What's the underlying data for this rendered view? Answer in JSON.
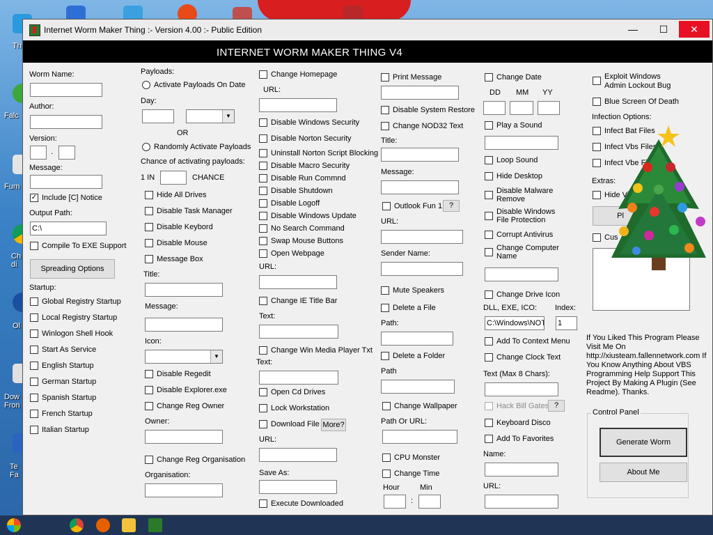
{
  "window": {
    "title": "Internet Worm Maker Thing :- Version 4.00 :- Public Edition",
    "banner": "INTERNET WORM MAKER THING V4",
    "controls": {
      "minimize": "—",
      "maximize": "☐",
      "close": "✕"
    }
  },
  "col1": {
    "worm_name_label": "Worm Name:",
    "author_label": "Author:",
    "version_label": "Version:",
    "version_dot": ".",
    "message_label": "Message:",
    "include_notice": "Include [C] Notice",
    "output_path_label": "Output Path:",
    "output_path_value": "C:\\",
    "compile_exe": "Compile To EXE Support",
    "spreading_options": "Spreading Options",
    "startup_label": "Startup:",
    "startup_items": [
      "Global Registry Startup",
      "Local Registry Startup",
      "Winlogon Shell Hook",
      "Start As Service",
      "English Startup",
      "German Startup",
      "Spanish Startup",
      "French Startup",
      "Italian Startup"
    ]
  },
  "col2": {
    "payloads_label": "Payloads:",
    "activate_on_date": "Activate Payloads On Date",
    "day_label": "Day:",
    "or_label": "OR",
    "randomly_activate": "Randomly Activate Payloads",
    "chance_label": "Chance of activating payloads:",
    "one_in": "1 IN",
    "chance": "CHANCE",
    "items1": [
      "Hide All Drives",
      "Disable Task Manager",
      "Disable Keybord",
      "Disable Mouse",
      "Message Box"
    ],
    "title_label": "Title:",
    "message_label": "Message:",
    "icon_label": "Icon:",
    "items2": [
      "Disable Regedit",
      "Disable Explorer.exe",
      "Change Reg Owner"
    ],
    "owner_label": "Owner:",
    "change_reg_org": "Change Reg Organisation",
    "organisation_label": "Organisation:"
  },
  "col3": {
    "change_homepage": "Change Homepage",
    "url_label": "URL:",
    "items1": [
      "Disable Windows Security",
      "Disable Norton Security",
      "Uninstall Norton Script Blocking",
      "Disable Macro Security",
      "Disable Run Commnd",
      "Disable Shutdown",
      "Disable Logoff",
      "Disable Windows Update",
      "No Search Command",
      "Swap Mouse Buttons",
      "Open Webpage"
    ],
    "url_label2": "URL:",
    "change_ie_title": "Change IE Title Bar",
    "text_label": "Text:",
    "change_media_player": "Change Win Media Player Txt",
    "text_label2": "Text:",
    "open_cd": "Open Cd Drives",
    "lock_workstation": "Lock Workstation",
    "download_file": "Download File",
    "more_btn": "More?",
    "url_label3": "URL:",
    "save_as_label": "Save As:",
    "execute_downloaded": "Execute Downloaded"
  },
  "col4": {
    "print_message": "Print Message",
    "disable_system_restore": "Disable System Restore",
    "change_nod32": "Change NOD32 Text",
    "title_label": "Title:",
    "message_label": "Message:",
    "outlook_fun": "Outlook Fun 1",
    "question_btn": "?",
    "url_label": "URL:",
    "sender_name_label": "Sender Name:",
    "mute_speakers": "Mute Speakers",
    "delete_file": "Delete a File",
    "path_label": "Path:",
    "delete_folder": "Delete a Folder",
    "path_label2": "Path",
    "change_wallpaper": "Change Wallpaper",
    "path_or_url_label": "Path Or URL:",
    "cpu_monster": "CPU Monster",
    "change_time": "Change Time",
    "hour_label": "Hour",
    "min_label": "Min",
    "time_sep": ":"
  },
  "col5": {
    "change_date": "Change Date",
    "dd": "DD",
    "mm": "MM",
    "yy": "YY",
    "play_sound": "Play a Sound",
    "loop_sound": "Loop Sound",
    "hide_desktop": "Hide Desktop",
    "disable_malware": "Disable Malware Remove",
    "disable_wfp": "Disable Windows File Protection",
    "corrupt_antivirus": "Corrupt Antivirus",
    "change_computer_name": "Change Computer Name",
    "change_drive_icon": "Change Drive Icon",
    "dll_label": "DLL, EXE, ICO:",
    "index_label": "Index:",
    "dll_value": "C:\\Windows\\NOT",
    "index_value": "1",
    "add_context_menu": "Add To Context Menu",
    "change_clock_text": "Change Clock Text",
    "text_max_label": "Text (Max 8 Chars):",
    "hack_bill_gates": "Hack Bill Gates",
    "question_btn": "?",
    "keyboard_disco": "Keyboard Disco",
    "add_favorites": "Add To Favorites",
    "name_label": "Name:",
    "url_label": "URL:"
  },
  "col6": {
    "exploit_windows": "Exploit Windows",
    "exploit_windows_2": "Admin Lockout Bug",
    "bsod": "Blue Screen Of Death",
    "infection_label": "Infection Options:",
    "infect_bat": "Infect Bat Files",
    "infect_vbs": "Infect Vbs Files",
    "infect_vbe": "Infect Vbe Fi",
    "extras_label": "Extras:",
    "hide_vi": "Hide Vi",
    "plugin_btn": "Pl",
    "cus_label": "Cus",
    "info_text": "If You Liked This Program Please Visit Me On http://xiusteam.fallennetwork.com If You Know Anything About VBS Programming Help Support This Project By Making A Plugin (See Readme). Thanks.",
    "control_panel": "Control Panel",
    "generate_worm": "Generate Worm",
    "about_me": "About Me"
  },
  "desktop": {
    "labels": [
      "Th",
      "Falc",
      "Furn",
      "Ch di",
      "Ol",
      "Dow Fron",
      "Te Fa"
    ]
  },
  "colors": {
    "banner": "#000000",
    "close": "#e81123",
    "accent": "#d81e1e"
  }
}
